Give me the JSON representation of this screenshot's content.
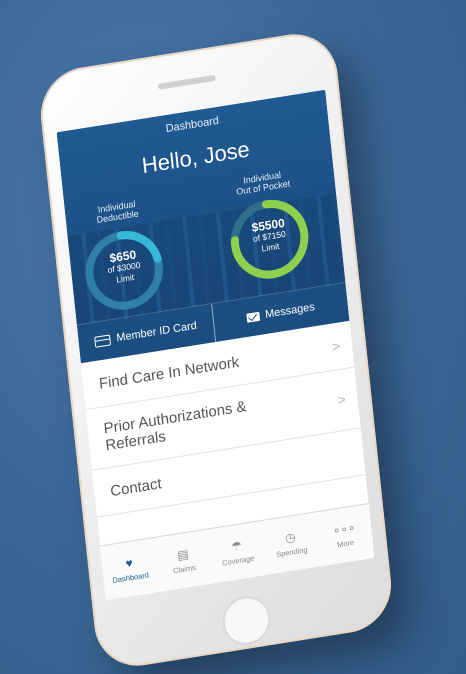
{
  "screen": {
    "title": "Dashboard",
    "greeting": "Hello, Jose"
  },
  "deductible": {
    "label_line1": "Individual",
    "label_line2": "Deductible",
    "amount": "$650",
    "limit_line1": "of $3000",
    "limit_line2": "Limit",
    "progress": 0.22,
    "color": "#38b8d8"
  },
  "out_of_pocket": {
    "label_line1": "Individual",
    "label_line2": "Out of Pocket",
    "amount": "$5500",
    "limit_line1": "of $7150",
    "limit_line2": "Limit",
    "progress": 0.77,
    "color": "#8fd14f"
  },
  "actions": {
    "member_id": "Member ID Card",
    "messages": "Messages",
    "member_icon": "id-card-icon",
    "messages_icon": "mail-icon"
  },
  "menu": [
    {
      "label": "Find Care In Network"
    },
    {
      "label_line1": "Prior Authorizations &",
      "label_line2": "Referrals"
    },
    {
      "label": "Contact"
    }
  ],
  "chevron": ">",
  "tabs": [
    {
      "label": "Dashboard",
      "icon": "heart-pulse-icon",
      "active": true
    },
    {
      "label": "Claims",
      "icon": "document-icon"
    },
    {
      "label": "Coverage",
      "icon": "umbrella-icon"
    },
    {
      "label": "Spending",
      "icon": "clock-icon"
    },
    {
      "label": "More",
      "icon": "more-dots-icon"
    }
  ],
  "colors": {
    "header_blue": "#1c4f85",
    "background": "#3f6b9b"
  }
}
